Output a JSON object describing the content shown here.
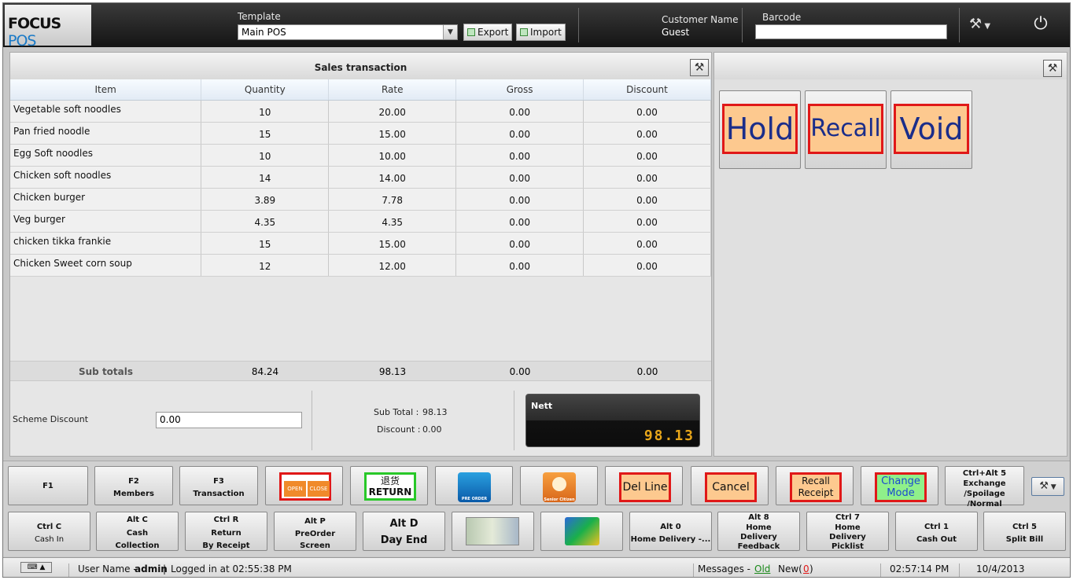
{
  "app": {
    "logo_a": "FOCUS",
    "logo_b": "POS"
  },
  "header": {
    "template_label": "Template",
    "template_value": "Main POS",
    "export_label": "Export",
    "import_label": "Import",
    "customer_label": "Customer Name",
    "customer_value": "Guest",
    "barcode_label": "Barcode"
  },
  "sales": {
    "title": "Sales transaction",
    "columns": [
      "Item",
      "Quantity",
      "Rate",
      "Gross",
      "Discount"
    ],
    "rows": [
      [
        "Vegetable soft noodles",
        "10",
        "20.00",
        "0.00",
        "0.00"
      ],
      [
        "Pan fried noodle",
        "15",
        "15.00",
        "0.00",
        "0.00"
      ],
      [
        "Egg Soft noodles",
        "10",
        "10.00",
        "0.00",
        "0.00"
      ],
      [
        "Chicken soft noodles",
        "14",
        "14.00",
        "0.00",
        "0.00"
      ],
      [
        "Chicken burger",
        "3.89",
        "7.78",
        "0.00",
        "0.00"
      ],
      [
        "Veg burger",
        "4.35",
        "4.35",
        "0.00",
        "0.00"
      ],
      [
        "chicken tikka frankie",
        "15",
        "15.00",
        "0.00",
        "0.00"
      ],
      [
        "Chicken Sweet corn soup",
        "12",
        "12.00",
        "0.00",
        "0.00"
      ]
    ],
    "subtotals": {
      "label": "Sub totals",
      "quantity": "84.24",
      "rate": "98.13",
      "gross": "0.00",
      "discount": "0.00"
    },
    "scheme_label": "Scheme Discount",
    "scheme_value": "0.00",
    "subtotal_label": "Sub Total :",
    "subtotal_value": "98.13",
    "discount_label": "Discount :",
    "discount_value": "0.00",
    "nett_label": "Nett",
    "nett_value": "98.13"
  },
  "actions": {
    "hold": "Hold",
    "recall": "Recall",
    "void": "Void"
  },
  "keys_row1": [
    {
      "l1": "F1",
      "l2": ""
    },
    {
      "l1": "F2",
      "l2": "Members"
    },
    {
      "l1": "F3",
      "l2": "Transaction"
    },
    {
      "open": "OPEN",
      "close": "CLOSE"
    },
    {
      "cn": "退货",
      "en": "RETURN"
    },
    {
      "label": "PRE ORDER"
    },
    {
      "label": "Senior Citizen"
    },
    {
      "face": "Del Line"
    },
    {
      "face": "Cancel"
    },
    {
      "face1": "Recall",
      "face2": "Receipt"
    },
    {
      "face1": "Change",
      "face2": "Mode"
    },
    {
      "l1": "Ctrl+Alt 5",
      "l2": "Exchange",
      "l3": "/Spoilage",
      "l4": "/Normal"
    }
  ],
  "keys_row2": [
    {
      "l1": "Ctrl C",
      "l2": "Cash In"
    },
    {
      "l1": "Alt C",
      "l2": "Cash",
      "l3": "Collection"
    },
    {
      "l1": "Ctrl R",
      "l2": "Return",
      "l3": "By Receipt"
    },
    {
      "l1": "Alt P",
      "l2": "PreOrder",
      "l3": "Screen"
    },
    {
      "l1": "Alt D",
      "l2": "Day End"
    },
    {
      "l1": "",
      "l2": ""
    },
    {
      "l1": "",
      "l2": ""
    },
    {
      "l1": "Alt 0",
      "l2": "Home Delivery -..."
    },
    {
      "l1": "Alt 8",
      "l2": "Home",
      "l3": "Delivery",
      "l4": "Feedback"
    },
    {
      "l1": "Ctrl 7",
      "l2": "Home",
      "l3": "Delivery",
      "l4": "Picklist"
    },
    {
      "l1": "Ctrl 1",
      "l2": "Cash Out"
    },
    {
      "l1": "Ctrl 5",
      "l2": "Split Bill"
    }
  ],
  "status": {
    "user_label": "User Name -",
    "user": "admin",
    "logged": "Logged in at 02:55:38 PM",
    "messages_label": "Messages -",
    "old": "Old",
    "new_label": "New(",
    "new_count": "0",
    "new_close": ")",
    "time": "02:57:14 PM",
    "date": "10/4/2013"
  },
  "colors": {
    "accent_red": "#e01818",
    "button_face": "#fdc98f",
    "nett_digits": "#e8a61a"
  }
}
